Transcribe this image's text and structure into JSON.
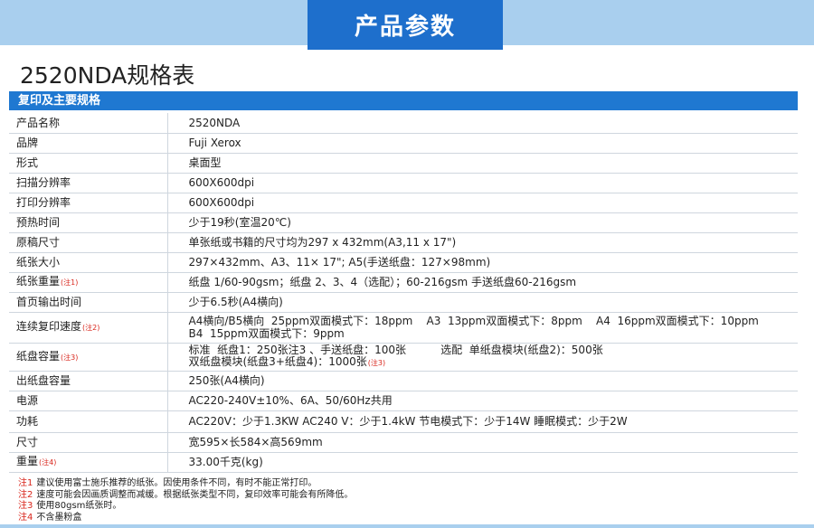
{
  "header": {
    "tab_title": "产品参数"
  },
  "doc": {
    "title": "2520NDA规格表"
  },
  "section": {
    "title": "复印及主要规格"
  },
  "rows": [
    {
      "key": "产品名称",
      "note": "",
      "value": "2520NDA"
    },
    {
      "key": "品牌",
      "note": "",
      "value": "Fuji Xerox"
    },
    {
      "key": "形式",
      "note": "",
      "value": "桌面型"
    },
    {
      "key": "扫描分辨率",
      "note": "",
      "value": "600X600dpi"
    },
    {
      "key": "打印分辨率",
      "note": "",
      "value": "600X600dpi"
    },
    {
      "key": "预热时间",
      "note": "",
      "value": "少于19秒(室温20℃)"
    },
    {
      "key": "原稿尺寸",
      "note": "",
      "value": "单张纸或书籍的尺寸均为297 x 432mm(A3,11 x 17\")"
    },
    {
      "key": "纸张大小",
      "note": "",
      "value": "297×432mm、A3、11× 17\"; A5(手送纸盘：127×98mm)"
    },
    {
      "key": "纸张重量",
      "note": "(注1)",
      "value": "纸盘 1/60-90gsm；纸盘 2、3、4（选配）；60-216gsm 手送纸盘60-216gsm"
    },
    {
      "key": "首页输出时间",
      "note": "",
      "value": "少于6.5秒(A4横向)"
    },
    {
      "key": "连续复印速度",
      "note": "(注2)",
      "value_lines": [
        "A4横向/B5横向  25ppm双面模式下：18ppm    A3  13ppm双面模式下：8ppm    A4  16ppm双面模式下：10ppm",
        "B4  15ppm双面模式下：9ppm"
      ]
    },
    {
      "key": "纸盘容量",
      "note": "(注3)",
      "value_line1": "标准  纸盘1：250张注3 、手送纸盘：100张          选配  单纸盘模块(纸盘2)：500张",
      "value_line2": "双纸盘模块(纸盘3+纸盘4)：1000张",
      "value_line2_note": "(注3)"
    },
    {
      "key": "出纸盘容量",
      "note": "",
      "value": "250张(A4横向)"
    },
    {
      "key": "电源",
      "note": "",
      "value": "AC220-240V±10%、6A、50/60Hz共用"
    },
    {
      "key": "功耗",
      "note": "",
      "value": "AC220V：少于1.3KW AC240 V：少于1.4kW 节电模式下：少于14W 睡眠模式：少于2W"
    },
    {
      "key": "尺寸",
      "note": "",
      "value": "宽595×长584×高569mm"
    },
    {
      "key": "重量",
      "note": "(注4)",
      "value": "33.00千克(kg)"
    }
  ],
  "footnotes": [
    {
      "mark": "注1",
      "text": "建议使用富士施乐推荐的纸张。因使用条件不同，有时不能正常打印。"
    },
    {
      "mark": "注2",
      "text": "速度可能会因画质调整而减缓。根据纸张类型不同，复印效率可能会有所降低。"
    },
    {
      "mark": "注3",
      "text": "使用80gsm纸张时。"
    },
    {
      "mark": "注4",
      "text": "不含墨粉盒"
    }
  ]
}
